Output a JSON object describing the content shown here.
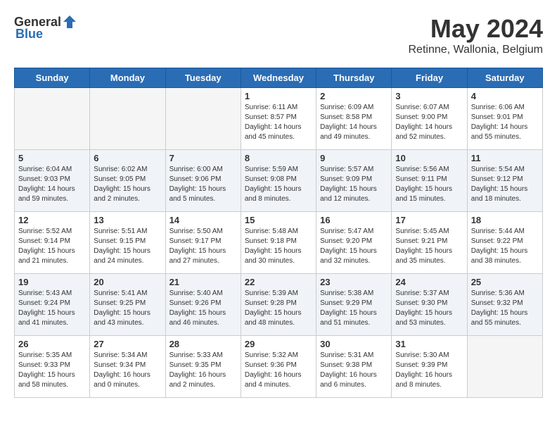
{
  "header": {
    "logo_general": "General",
    "logo_blue": "Blue",
    "month": "May 2024",
    "location": "Retinne, Wallonia, Belgium"
  },
  "days_of_week": [
    "Sunday",
    "Monday",
    "Tuesday",
    "Wednesday",
    "Thursday",
    "Friday",
    "Saturday"
  ],
  "weeks": [
    [
      {
        "day": "",
        "info": ""
      },
      {
        "day": "",
        "info": ""
      },
      {
        "day": "",
        "info": ""
      },
      {
        "day": "1",
        "info": "Sunrise: 6:11 AM\nSunset: 8:57 PM\nDaylight: 14 hours and 45 minutes."
      },
      {
        "day": "2",
        "info": "Sunrise: 6:09 AM\nSunset: 8:58 PM\nDaylight: 14 hours and 49 minutes."
      },
      {
        "day": "3",
        "info": "Sunrise: 6:07 AM\nSunset: 9:00 PM\nDaylight: 14 hours and 52 minutes."
      },
      {
        "day": "4",
        "info": "Sunrise: 6:06 AM\nSunset: 9:01 PM\nDaylight: 14 hours and 55 minutes."
      }
    ],
    [
      {
        "day": "5",
        "info": "Sunrise: 6:04 AM\nSunset: 9:03 PM\nDaylight: 14 hours and 59 minutes."
      },
      {
        "day": "6",
        "info": "Sunrise: 6:02 AM\nSunset: 9:05 PM\nDaylight: 15 hours and 2 minutes."
      },
      {
        "day": "7",
        "info": "Sunrise: 6:00 AM\nSunset: 9:06 PM\nDaylight: 15 hours and 5 minutes."
      },
      {
        "day": "8",
        "info": "Sunrise: 5:59 AM\nSunset: 9:08 PM\nDaylight: 15 hours and 8 minutes."
      },
      {
        "day": "9",
        "info": "Sunrise: 5:57 AM\nSunset: 9:09 PM\nDaylight: 15 hours and 12 minutes."
      },
      {
        "day": "10",
        "info": "Sunrise: 5:56 AM\nSunset: 9:11 PM\nDaylight: 15 hours and 15 minutes."
      },
      {
        "day": "11",
        "info": "Sunrise: 5:54 AM\nSunset: 9:12 PM\nDaylight: 15 hours and 18 minutes."
      }
    ],
    [
      {
        "day": "12",
        "info": "Sunrise: 5:52 AM\nSunset: 9:14 PM\nDaylight: 15 hours and 21 minutes."
      },
      {
        "day": "13",
        "info": "Sunrise: 5:51 AM\nSunset: 9:15 PM\nDaylight: 15 hours and 24 minutes."
      },
      {
        "day": "14",
        "info": "Sunrise: 5:50 AM\nSunset: 9:17 PM\nDaylight: 15 hours and 27 minutes."
      },
      {
        "day": "15",
        "info": "Sunrise: 5:48 AM\nSunset: 9:18 PM\nDaylight: 15 hours and 30 minutes."
      },
      {
        "day": "16",
        "info": "Sunrise: 5:47 AM\nSunset: 9:20 PM\nDaylight: 15 hours and 32 minutes."
      },
      {
        "day": "17",
        "info": "Sunrise: 5:45 AM\nSunset: 9:21 PM\nDaylight: 15 hours and 35 minutes."
      },
      {
        "day": "18",
        "info": "Sunrise: 5:44 AM\nSunset: 9:22 PM\nDaylight: 15 hours and 38 minutes."
      }
    ],
    [
      {
        "day": "19",
        "info": "Sunrise: 5:43 AM\nSunset: 9:24 PM\nDaylight: 15 hours and 41 minutes."
      },
      {
        "day": "20",
        "info": "Sunrise: 5:41 AM\nSunset: 9:25 PM\nDaylight: 15 hours and 43 minutes."
      },
      {
        "day": "21",
        "info": "Sunrise: 5:40 AM\nSunset: 9:26 PM\nDaylight: 15 hours and 46 minutes."
      },
      {
        "day": "22",
        "info": "Sunrise: 5:39 AM\nSunset: 9:28 PM\nDaylight: 15 hours and 48 minutes."
      },
      {
        "day": "23",
        "info": "Sunrise: 5:38 AM\nSunset: 9:29 PM\nDaylight: 15 hours and 51 minutes."
      },
      {
        "day": "24",
        "info": "Sunrise: 5:37 AM\nSunset: 9:30 PM\nDaylight: 15 hours and 53 minutes."
      },
      {
        "day": "25",
        "info": "Sunrise: 5:36 AM\nSunset: 9:32 PM\nDaylight: 15 hours and 55 minutes."
      }
    ],
    [
      {
        "day": "26",
        "info": "Sunrise: 5:35 AM\nSunset: 9:33 PM\nDaylight: 15 hours and 58 minutes."
      },
      {
        "day": "27",
        "info": "Sunrise: 5:34 AM\nSunset: 9:34 PM\nDaylight: 16 hours and 0 minutes."
      },
      {
        "day": "28",
        "info": "Sunrise: 5:33 AM\nSunset: 9:35 PM\nDaylight: 16 hours and 2 minutes."
      },
      {
        "day": "29",
        "info": "Sunrise: 5:32 AM\nSunset: 9:36 PM\nDaylight: 16 hours and 4 minutes."
      },
      {
        "day": "30",
        "info": "Sunrise: 5:31 AM\nSunset: 9:38 PM\nDaylight: 16 hours and 6 minutes."
      },
      {
        "day": "31",
        "info": "Sunrise: 5:30 AM\nSunset: 9:39 PM\nDaylight: 16 hours and 8 minutes."
      },
      {
        "day": "",
        "info": ""
      }
    ]
  ]
}
